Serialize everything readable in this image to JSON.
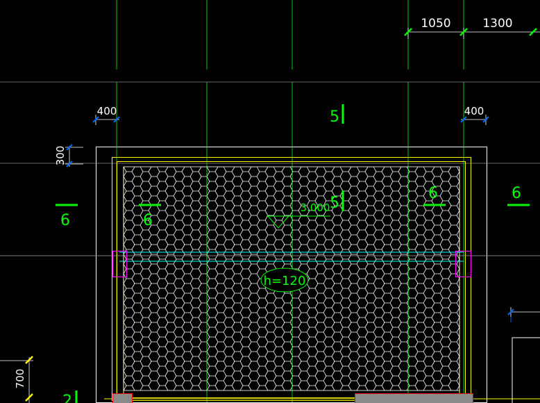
{
  "dimensions": {
    "top_left": "1050",
    "top_right": "1300",
    "left_gap": "400",
    "right_gap": "400",
    "side_offset": "300",
    "bottom_left": "700"
  },
  "labels": {
    "section_5_top": "5",
    "section_5_inner": "5",
    "section_6_far_left": "6",
    "section_6_left": "6",
    "section_6_right": "6",
    "section_6_far_right": "6",
    "section_2_bottom": "2"
  },
  "slab": {
    "elevation": "3.000",
    "thickness": "h=120"
  },
  "colors": {
    "background": "#000000",
    "green": "#00ff00",
    "cyan": "#00ffff",
    "yellow": "#ffff00",
    "white": "#ffffff",
    "magenta": "#ff00ff",
    "blue": "#0066ff",
    "red": "#ff0000",
    "gray": "#808080"
  }
}
